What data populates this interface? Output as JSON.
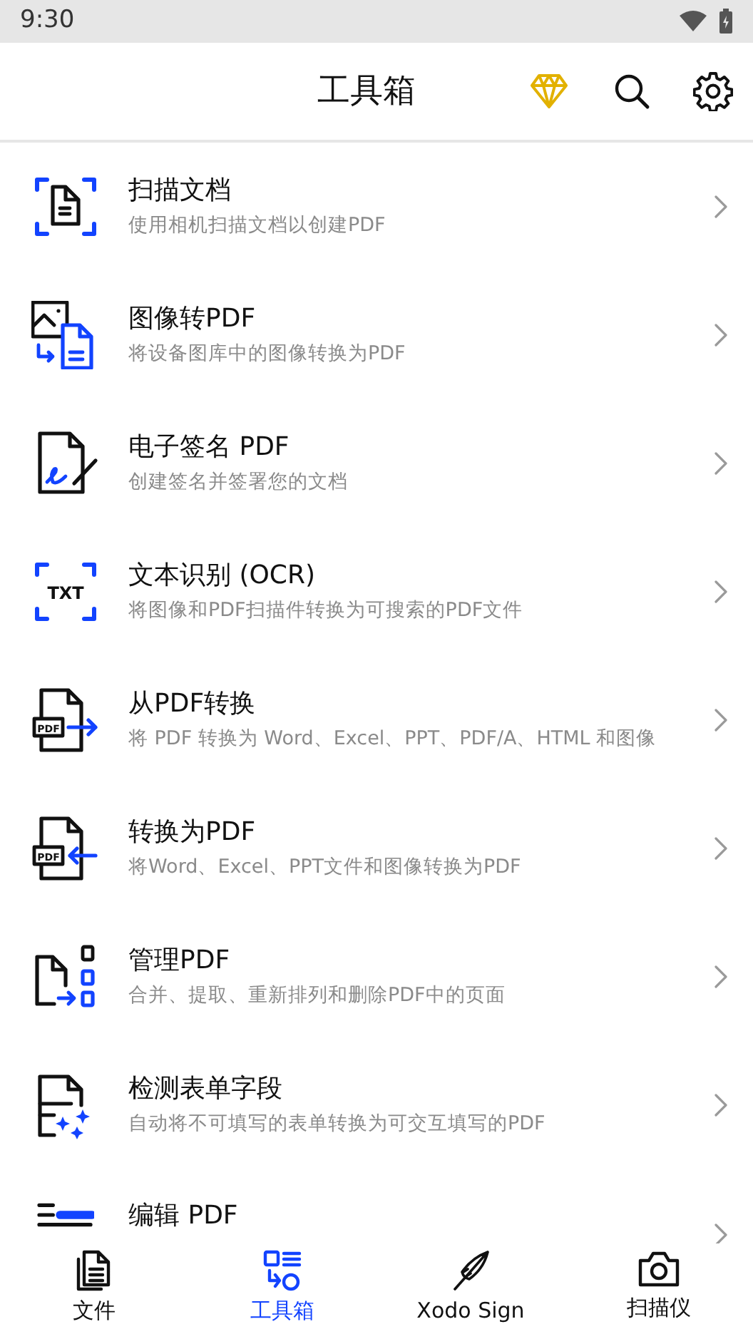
{
  "status_bar": {
    "time": "9:30"
  },
  "header": {
    "title": "工具箱"
  },
  "tools": [
    {
      "kind": "scan",
      "title": "扫描文档",
      "subtitle": "使用相机扫描文档以创建PDF"
    },
    {
      "kind": "image",
      "title": "图像转PDF",
      "subtitle": "将设备图库中的图像转换为PDF"
    },
    {
      "kind": "sign",
      "title": "电子签名 PDF",
      "subtitle": "创建签名并签署您的文档"
    },
    {
      "kind": "ocr",
      "title": "文本识别 (OCR)",
      "subtitle": "将图像和PDF扫描件转换为可搜索的PDF文件",
      "icon_text": "TXT"
    },
    {
      "kind": "from_pdf",
      "title": "从PDF转换",
      "subtitle": "将 PDF 转换为 Word、Excel、PPT、PDF/A、HTML 和图像",
      "icon_text": "PDF"
    },
    {
      "kind": "to_pdf",
      "title": "转换为PDF",
      "subtitle": "将Word、Excel、PPT文件和图像转换为PDF",
      "icon_text": "PDF"
    },
    {
      "kind": "manage",
      "title": "管理PDF",
      "subtitle": "合并、提取、重新排列和删除PDF中的页面"
    },
    {
      "kind": "form",
      "title": "检测表单字段",
      "subtitle": "自动将不可填写的表单转换为可交互填写的PDF"
    },
    {
      "kind": "edit",
      "title": "编辑 PDF"
    }
  ],
  "bottom_nav": [
    {
      "kind": "files",
      "label": "文件",
      "selected": false
    },
    {
      "kind": "toolbox",
      "label": "工具箱",
      "selected": true
    },
    {
      "kind": "feather",
      "label": "Xodo Sign",
      "selected": false
    },
    {
      "kind": "camera",
      "label": "扫描仪",
      "selected": false
    }
  ]
}
